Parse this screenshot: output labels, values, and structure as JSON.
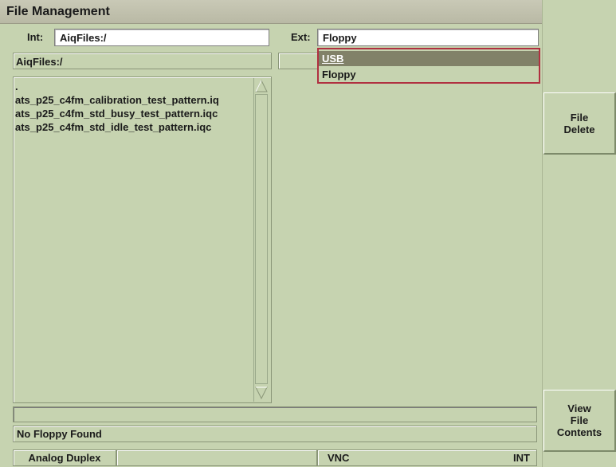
{
  "window": {
    "title": "File Management"
  },
  "int_field": {
    "label": "Int:",
    "value": "AiqFiles:/"
  },
  "ext_field": {
    "label": "Ext:",
    "value": "Floppy"
  },
  "ext_dropdown": {
    "options": [
      "USB",
      "Floppy"
    ],
    "highlighted": "USB"
  },
  "int_path": "AiqFiles:/",
  "ext_path": "",
  "file_list": {
    "items": [
      ".",
      "ats_p25_c4fm_calibration_test_pattern.iq",
      "ats_p25_c4fm_std_busy_test_pattern.iqc",
      "ats_p25_c4fm_std_idle_test_pattern.iqc"
    ]
  },
  "messages": {
    "line1": "",
    "line2": "No Floppy Found"
  },
  "side_buttons": {
    "file_delete": "File\nDelete",
    "view_file_contents": "View\nFile\nContents"
  },
  "status_bar": {
    "mode": "Analog Duplex",
    "cell2": "",
    "connection": "VNC",
    "source": "INT"
  },
  "colors": {
    "background": "#c6d3b0",
    "title_bar": "#c0c0ac",
    "dropdown_border": "#b03040",
    "dropdown_highlight": "#818168"
  }
}
